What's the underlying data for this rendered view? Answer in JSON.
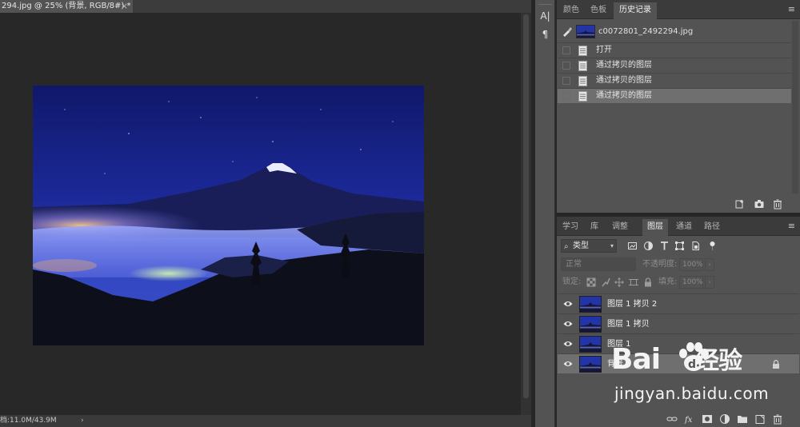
{
  "document": {
    "tab_title": "294.jpg @ 25% (背景, RGB/8#) *",
    "tab_close": "×",
    "status_text": "档:11.0M/43.9M",
    "status_arrow": "›"
  },
  "mini_toolbar": {
    "items": [
      {
        "glyph": "A|",
        "icon": "character-icon"
      },
      {
        "glyph": "¶",
        "icon": "paragraph-icon"
      }
    ]
  },
  "history_panel": {
    "tabs": [
      {
        "label": "颜色",
        "active": false
      },
      {
        "label": "色板",
        "active": false
      },
      {
        "label": "历史记录",
        "active": true
      }
    ],
    "menu_glyph": "≡",
    "snapshot_name": "c0072801_2492294.jpg",
    "entries": [
      {
        "label": "打开",
        "selected": false
      },
      {
        "label": "通过拷贝的图层",
        "selected": false
      },
      {
        "label": "通过拷贝的图层",
        "selected": false
      },
      {
        "label": "通过拷贝的图层",
        "selected": true
      }
    ],
    "footer_icons": [
      "new-document-from-state-icon",
      "new-snapshot-icon",
      "delete-state-icon"
    ]
  },
  "layers_panel": {
    "tabs": [
      {
        "label": "学习",
        "active": false
      },
      {
        "label": "库",
        "active": false
      },
      {
        "label": "调整",
        "active": false
      },
      {
        "label": "图层",
        "active": true
      },
      {
        "label": "通道",
        "active": false
      },
      {
        "label": "路径",
        "active": false
      }
    ],
    "menu_glyph": "≡",
    "kind_filter": "类型",
    "filter_icons": [
      "pixel-filter-icon",
      "adjustment-filter-icon",
      "type-filter-icon",
      "shape-filter-icon",
      "smart-object-filter-icon",
      "filter-toggle-icon"
    ],
    "blend_mode": "正常",
    "opacity_label": "不透明度:",
    "opacity_value": "100%",
    "lock_label": "锁定:",
    "fill_label": "填充:",
    "fill_value": "100%",
    "layers": [
      {
        "name": "图层 1 拷贝 2",
        "visible": true,
        "locked": false,
        "selected": false
      },
      {
        "name": "图层 1 拷贝",
        "visible": true,
        "locked": false,
        "selected": false
      },
      {
        "name": "图层 1",
        "visible": true,
        "locked": false,
        "selected": false
      },
      {
        "name": "背景",
        "visible": true,
        "locked": true,
        "selected": true
      }
    ],
    "footer_icons": [
      "link-layers-icon",
      "fx-icon",
      "add-mask-icon",
      "new-adjustment-layer-icon",
      "new-group-icon",
      "new-layer-icon",
      "delete-layer-icon"
    ]
  },
  "watermark": {
    "logo_text": "Bai du 经验",
    "url_text": "jingyan.baidu.com"
  },
  "colors": {
    "workspace_bg": "#282828",
    "panel_bg": "#535353",
    "selected_row": "#6f6f6f",
    "sky_top": "#141c6e",
    "sky_bottom": "#3b4dc4"
  }
}
